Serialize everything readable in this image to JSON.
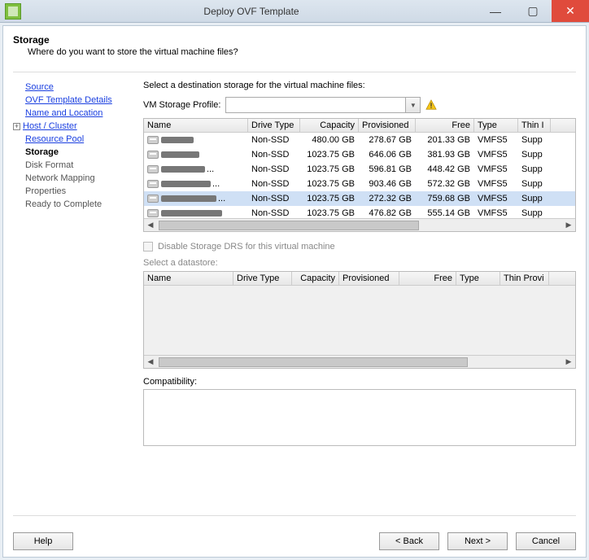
{
  "window": {
    "title": "Deploy OVF Template",
    "heading": "Storage",
    "subheading": "Where do you want to store the virtual machine files?"
  },
  "nav": {
    "items": [
      {
        "label": "Source",
        "kind": "link"
      },
      {
        "label": "OVF Template Details",
        "kind": "link"
      },
      {
        "label": "Name and Location",
        "kind": "link"
      },
      {
        "label": "Host / Cluster",
        "kind": "link",
        "tree": true
      },
      {
        "label": "Resource Pool",
        "kind": "link"
      },
      {
        "label": "Storage",
        "kind": "current"
      },
      {
        "label": "Disk Format",
        "kind": "plain"
      },
      {
        "label": "Network Mapping",
        "kind": "plain"
      },
      {
        "label": "Properties",
        "kind": "plain"
      },
      {
        "label": "Ready to Complete",
        "kind": "plain"
      }
    ]
  },
  "content": {
    "instruction": "Select a destination storage for the virtual machine files:",
    "profile_label": "VM Storage Profile:",
    "profile_value": "",
    "drs_label": "Disable Storage DRS for this virtual machine",
    "datastore_label": "Select a datastore:",
    "compat_label": "Compatibility:"
  },
  "grid": {
    "headers": [
      "Name",
      "Drive Type",
      "Capacity",
      "Provisioned",
      "Free",
      "Type",
      "Thin I"
    ],
    "rows": [
      {
        "drive": "Non-SSD",
        "cap": "480.00 GB",
        "prov": "278.67 GB",
        "free": "201.33 GB",
        "type": "VMFS5",
        "thin": "Supp",
        "sel": false
      },
      {
        "drive": "Non-SSD",
        "cap": "1023.75 GB",
        "prov": "646.06 GB",
        "free": "381.93 GB",
        "type": "VMFS5",
        "thin": "Supp",
        "sel": false
      },
      {
        "drive": "Non-SSD",
        "cap": "1023.75 GB",
        "prov": "596.81 GB",
        "free": "448.42 GB",
        "type": "VMFS5",
        "thin": "Supp",
        "sel": false
      },
      {
        "drive": "Non-SSD",
        "cap": "1023.75 GB",
        "prov": "903.46 GB",
        "free": "572.32 GB",
        "type": "VMFS5",
        "thin": "Supp",
        "sel": false
      },
      {
        "drive": "Non-SSD",
        "cap": "1023.75 GB",
        "prov": "272.32 GB",
        "free": "759.68 GB",
        "type": "VMFS5",
        "thin": "Supp",
        "sel": true
      },
      {
        "drive": "Non-SSD",
        "cap": "1023.75 GB",
        "prov": "476.82 GB",
        "free": "555.14 GB",
        "type": "VMFS5",
        "thin": "Supp",
        "sel": false
      }
    ]
  },
  "grid2": {
    "headers": [
      "Name",
      "Drive Type",
      "Capacity",
      "Provisioned",
      "Free",
      "Type",
      "Thin Provi"
    ]
  },
  "buttons": {
    "help": "Help",
    "back": "< Back",
    "next": "Next >",
    "cancel": "Cancel"
  }
}
